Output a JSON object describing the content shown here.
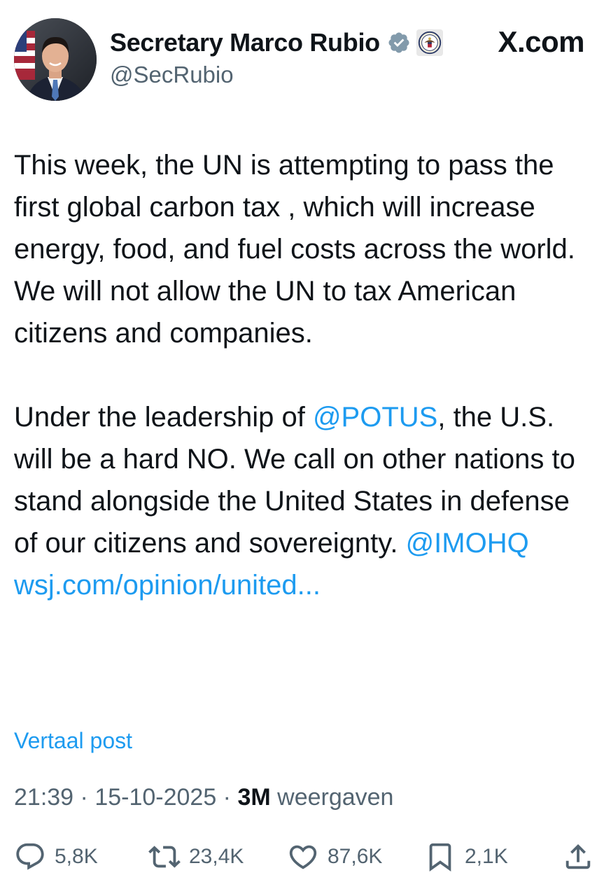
{
  "author": {
    "display_name": "Secretary Marco Rubio",
    "handle": "@SecRubio",
    "verified_badge_icon": "verified-badge-icon",
    "affiliation_icon": "state-department-seal-icon"
  },
  "watermark": "X.com",
  "post": {
    "paragraph1": "This week, the UN is attempting to pass the first global carbon tax , which will increase energy, food, and fuel costs across the world.  We will not allow the UN to tax American citizens and companies.",
    "paragraph2_prefix": "Under the leadership of ",
    "mention_potus": "@POTUS",
    "paragraph2_middle": ", the U.S. will be a hard NO.  We call on other nations to stand alongside the United States in defense of our citizens and sovereignty. ",
    "mention_imo": "@IMOHQ",
    "link": "wsj.com/opinion/united..."
  },
  "translate_label": "Vertaal post",
  "meta": {
    "time": "21:39",
    "separator": " · ",
    "date": "15-10-2025",
    "views_count": "3M",
    "views_label": " weergaven"
  },
  "actions": {
    "replies": "5,8K",
    "reposts": "23,4K",
    "likes": "87,6K",
    "bookmarks": "2,1K"
  },
  "colors": {
    "accent": "#1d9bf0",
    "secondary_text": "#536471",
    "primary_text": "#0f1419"
  }
}
